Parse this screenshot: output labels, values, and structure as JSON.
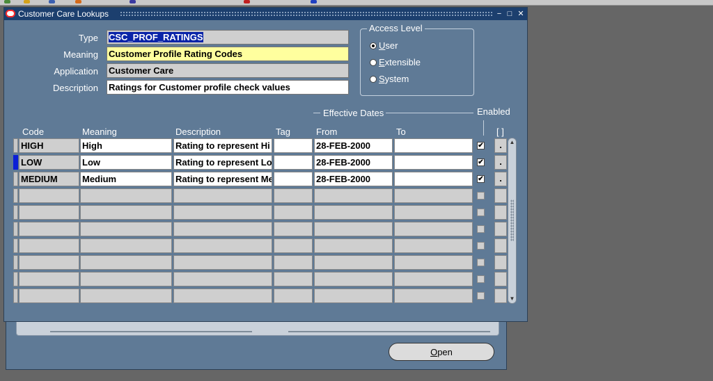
{
  "window": {
    "title": "Customer Care Lookups"
  },
  "header": {
    "type_label": "Type",
    "type_value": "CSC_PROF_RATINGS",
    "meaning_label": "Meaning",
    "meaning_value": "Customer Profile Rating Codes",
    "application_label": "Application",
    "application_value": "Customer Care",
    "description_label": "Description",
    "description_value": "Ratings for Customer profile check values"
  },
  "access_level": {
    "title": "Access Level",
    "options": [
      {
        "pre": "",
        "key": "U",
        "post": "ser",
        "selected": true
      },
      {
        "pre": "",
        "key": "E",
        "post": "xtensible",
        "selected": false
      },
      {
        "pre": "",
        "key": "S",
        "post": "ystem",
        "selected": false
      }
    ]
  },
  "table": {
    "effective_dates_label": "Effective Dates",
    "enabled_label": "Enabled",
    "dff_label": "[ ]",
    "columns": {
      "code": "Code",
      "meaning": "Meaning",
      "description": "Description",
      "tag": "Tag",
      "from": "From",
      "to": "To"
    },
    "rows": [
      {
        "code": "HIGH",
        "meaning": "High",
        "description": "Rating to represent Hi",
        "tag": "",
        "from": "28-FEB-2000",
        "to": "",
        "enabled": true,
        "dff": "."
      },
      {
        "code": "LOW",
        "meaning": "Low",
        "description": "Rating to represent Lo",
        "tag": "",
        "from": "28-FEB-2000",
        "to": "",
        "enabled": true,
        "dff": "."
      },
      {
        "code": "MEDIUM",
        "meaning": "Medium",
        "description": "Rating to represent Me",
        "tag": "",
        "from": "28-FEB-2000",
        "to": "",
        "enabled": true,
        "dff": "."
      },
      {
        "code": "",
        "meaning": "",
        "description": "",
        "tag": "",
        "from": "",
        "to": "",
        "enabled": false,
        "dff": ""
      },
      {
        "code": "",
        "meaning": "",
        "description": "",
        "tag": "",
        "from": "",
        "to": "",
        "enabled": false,
        "dff": ""
      },
      {
        "code": "",
        "meaning": "",
        "description": "",
        "tag": "",
        "from": "",
        "to": "",
        "enabled": false,
        "dff": ""
      },
      {
        "code": "",
        "meaning": "",
        "description": "",
        "tag": "",
        "from": "",
        "to": "",
        "enabled": false,
        "dff": ""
      },
      {
        "code": "",
        "meaning": "",
        "description": "",
        "tag": "",
        "from": "",
        "to": "",
        "enabled": false,
        "dff": ""
      },
      {
        "code": "",
        "meaning": "",
        "description": "",
        "tag": "",
        "from": "",
        "to": "",
        "enabled": false,
        "dff": ""
      },
      {
        "code": "",
        "meaning": "",
        "description": "",
        "tag": "",
        "from": "",
        "to": "",
        "enabled": false,
        "dff": ""
      }
    ],
    "active_row": 1
  },
  "background_window": {
    "open_button": {
      "key": "O",
      "rest": "pen"
    }
  },
  "colors": {
    "window_bg": "#5f7a96",
    "title_bar": "#1c3f6e",
    "selection": "#0a24a8",
    "required_field": "#ffff9e"
  }
}
